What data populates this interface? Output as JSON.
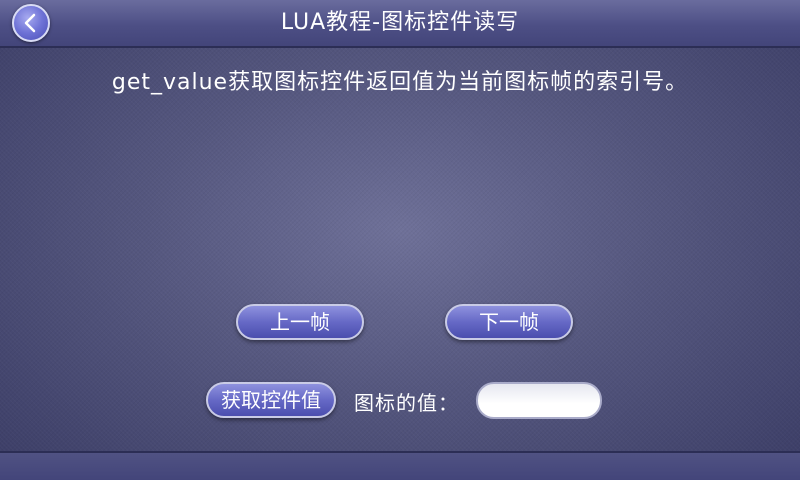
{
  "header": {
    "title": "LUA教程-图标控件读写"
  },
  "main": {
    "description": "get_value获取图标控件返回值为当前图标帧的索引号。",
    "prev_frame_label": "上一帧",
    "next_frame_label": "下一帧",
    "get_value_label": "获取控件值",
    "icon_value_label": "图标的值：",
    "icon_value": ""
  },
  "colors": {
    "background": "#55577f",
    "titlebar": "#4d4f85",
    "button": "#6669c6"
  }
}
